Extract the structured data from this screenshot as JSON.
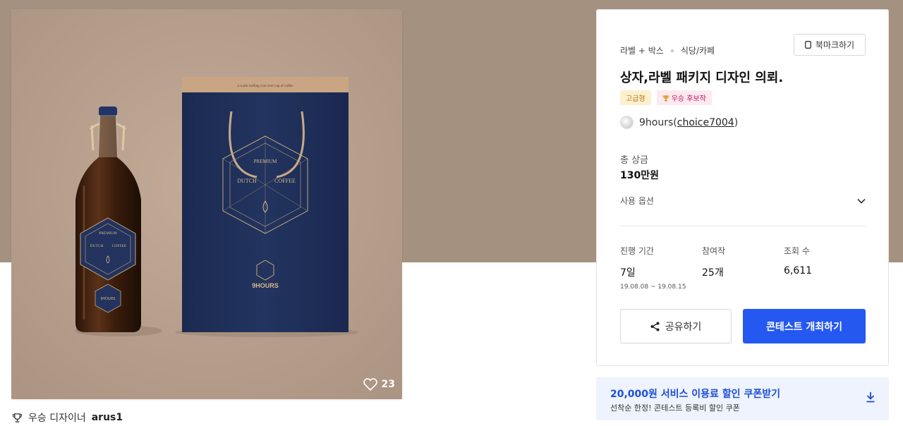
{
  "gallery": {
    "like_count": "23",
    "winner_label": "우승 디자이너",
    "winner_name": "arus1",
    "box_top_text": "a warm welling your ever cup of coffee",
    "emblem_top": "PREMIUM",
    "emblem_left": "DUTCH",
    "emblem_right": "COFFEE",
    "brand": "9HOURS"
  },
  "contest": {
    "category": "라벨 + 박스",
    "subcategory": "식당/카페",
    "bookmark_label": "북마크하기",
    "title": "상자,라벨 패키지 디자인 의뢰.",
    "badges": [
      {
        "label": "고급형"
      },
      {
        "label": "우승 후보작"
      }
    ],
    "designer_name": "9hours",
    "designer_handle": "choice7004",
    "prize_label": "총 상금",
    "prize_value": "130만원",
    "options_label": "사용 옵션",
    "stats": {
      "period_label": "진행 기간",
      "period_value": "7일",
      "period_range": "19.08.08  ~  19.08.15",
      "entries_label": "참여작",
      "entries_value": "25개",
      "views_label": "조회 수",
      "views_value": "6,611"
    },
    "share_label": "공유하기",
    "host_label": "콘테스트 개최하기"
  },
  "coupon": {
    "title": "20,000원 서비스 이용료 할인 쿠폰받기",
    "subtitle": "선착순 한정! 콘테스트 등록비 할인 쿠폰"
  },
  "colors": {
    "band": "#a5917f",
    "photo_bg": "#b8a08e",
    "primary": "#2458f0",
    "coupon_text": "#1d4ed8",
    "navy_box": "#1f2f5b"
  },
  "icons": [
    "heart-icon",
    "trophy-icon",
    "bookmark-icon",
    "chevron-down-icon",
    "share-icon",
    "download-icon"
  ]
}
